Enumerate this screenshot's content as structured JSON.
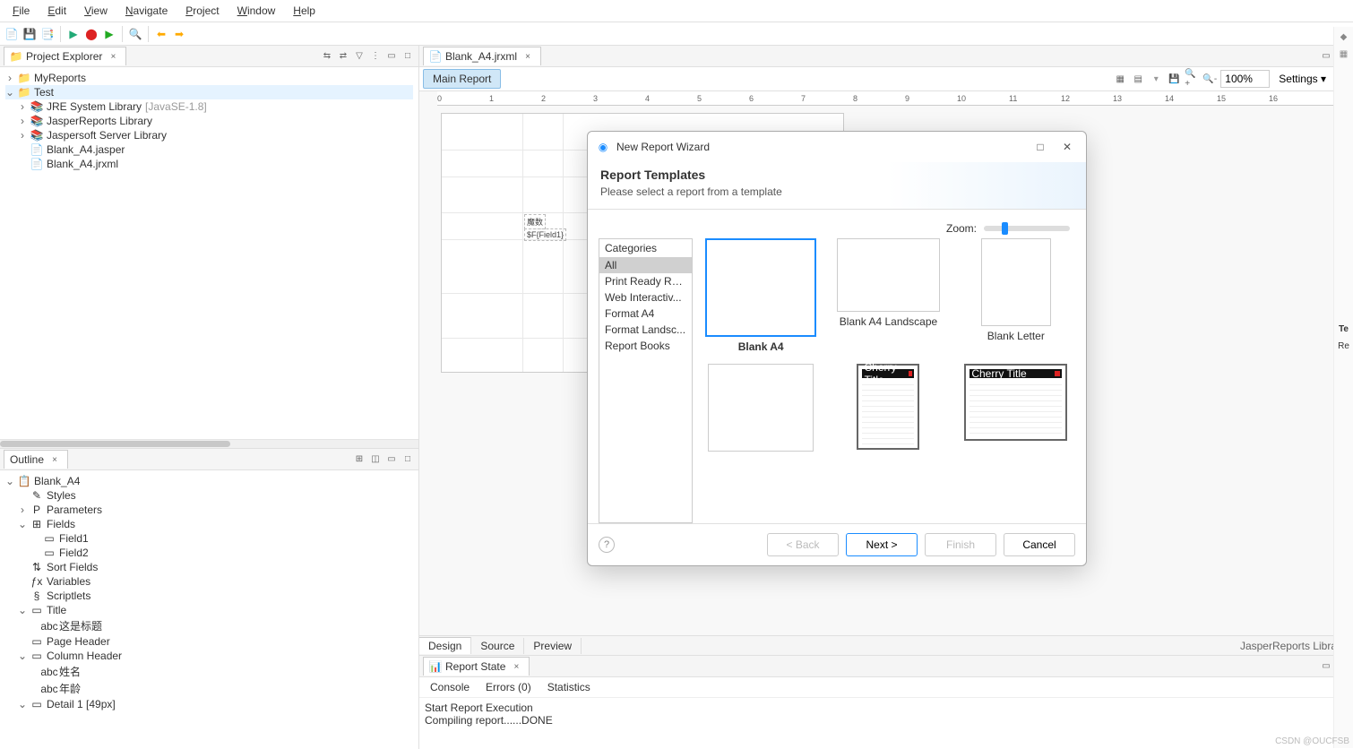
{
  "menu": {
    "file": "File",
    "edit": "Edit",
    "view": "View",
    "navigate": "Navigate",
    "project": "Project",
    "window": "Window",
    "help": "Help"
  },
  "explorer": {
    "title": "Project Explorer",
    "nodes": [
      {
        "label": "MyReports",
        "level": 0,
        "caret": ">",
        "icon": "folder"
      },
      {
        "label": "Test",
        "level": 0,
        "caret": "v",
        "icon": "folder",
        "selected": true
      },
      {
        "label": "JRE System Library",
        "suffix": "[JavaSE-1.8]",
        "level": 1,
        "caret": ">",
        "icon": "lib"
      },
      {
        "label": "JasperReports Library",
        "level": 1,
        "caret": ">",
        "icon": "lib"
      },
      {
        "label": "Jaspersoft Server Library",
        "level": 1,
        "caret": ">",
        "icon": "lib"
      },
      {
        "label": "Blank_A4.jasper",
        "level": 1,
        "caret": "",
        "icon": "file"
      },
      {
        "label": "Blank_A4.jrxml",
        "level": 1,
        "caret": "",
        "icon": "file"
      }
    ]
  },
  "outline": {
    "title": "Outline",
    "nodes": [
      {
        "label": "Blank_A4",
        "level": 0,
        "caret": "v",
        "icon": "report"
      },
      {
        "label": "Styles",
        "level": 1,
        "caret": "",
        "icon": "style"
      },
      {
        "label": "Parameters",
        "level": 1,
        "caret": ">",
        "icon": "param"
      },
      {
        "label": "Fields",
        "level": 1,
        "caret": "v",
        "icon": "fields"
      },
      {
        "label": "Field1",
        "level": 2,
        "caret": "",
        "icon": "field"
      },
      {
        "label": "Field2",
        "level": 2,
        "caret": "",
        "icon": "field"
      },
      {
        "label": "Sort Fields",
        "level": 1,
        "caret": "",
        "icon": "sort"
      },
      {
        "label": "Variables",
        "level": 1,
        "caret": "",
        "icon": "fx"
      },
      {
        "label": "Scriptlets",
        "level": 1,
        "caret": "",
        "icon": "script"
      },
      {
        "label": "Title",
        "level": 1,
        "caret": "v",
        "icon": "band"
      },
      {
        "label": "这是标题",
        "level": 2,
        "caret": "",
        "icon": "text"
      },
      {
        "label": "Page Header",
        "level": 1,
        "caret": "",
        "icon": "band"
      },
      {
        "label": "Column Header",
        "level": 1,
        "caret": "v",
        "icon": "band"
      },
      {
        "label": "姓名",
        "level": 2,
        "caret": "",
        "icon": "text"
      },
      {
        "label": "年龄",
        "level": 2,
        "caret": "",
        "icon": "text"
      },
      {
        "label": "Detail 1 [49px]",
        "level": 1,
        "caret": "v",
        "icon": "band"
      }
    ]
  },
  "editor": {
    "tab": "Blank_A4.jrxml",
    "subtab": "Main Report",
    "zoom": "100%",
    "settings": "Settings",
    "bottom_tabs": {
      "design": "Design",
      "source": "Source",
      "preview": "Preview"
    },
    "lib": "JasperReports Library",
    "ruler_marks": [
      "0",
      "1",
      "2",
      "3",
      "4",
      "5",
      "6",
      "7",
      "8",
      "9",
      "10",
      "11",
      "12",
      "13",
      "14",
      "15",
      "16"
    ],
    "page": {
      "field_label": "魔数",
      "field_expr": "$F{Field1}"
    }
  },
  "console": {
    "title": "Report State",
    "tabs": {
      "console": "Console",
      "errors": "Errors (0)",
      "stats": "Statistics"
    },
    "line1": "Start Report Execution",
    "line2": "Compiling report......DONE"
  },
  "dialog": {
    "title": "New Report Wizard",
    "heading": "Report Templates",
    "subtitle": "Please select a report from a template",
    "zoom_label": "Zoom:",
    "categories_title": "Categories",
    "categories": [
      "All",
      "Print Ready Re...",
      "Web Interactiv...",
      "Format A4",
      "Format Landsc...",
      "Report Books"
    ],
    "selected_category": "All",
    "templates": [
      {
        "name": "Blank A4",
        "shape": "a4",
        "selected": true
      },
      {
        "name": "Blank A4 Landscape",
        "shape": "landscape"
      },
      {
        "name": "Blank Letter",
        "shape": "letter"
      },
      {
        "name": "",
        "shape": "a4"
      },
      {
        "name": "",
        "shape": "cherry"
      },
      {
        "name": "",
        "shape": "cherry-wide"
      }
    ],
    "buttons": {
      "help": "?",
      "back": "< Back",
      "next": "Next >",
      "finish": "Finish",
      "cancel": "Cancel"
    }
  },
  "right_gutter": {
    "te": "Te",
    "re": "Re"
  },
  "watermark": "CSDN @OUCFSB"
}
